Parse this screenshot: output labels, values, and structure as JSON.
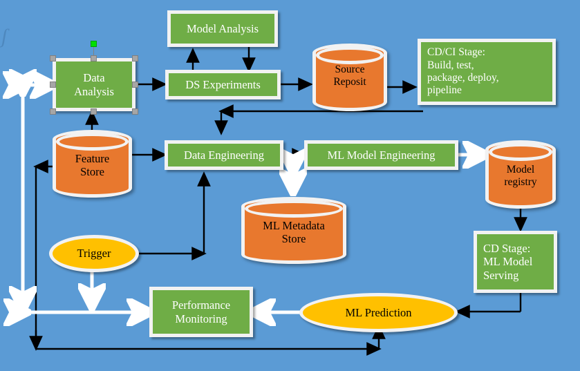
{
  "diagram": {
    "title": "MLOps pipeline flow diagram",
    "background_color": "#5B9BD5",
    "watermark": "ʃ",
    "colors": {
      "background": "#5B9BD5",
      "process_green": "#6FAD46",
      "datastore_orange": "#E8782E",
      "terminal_yellow": "#FFC000",
      "node_border": "#F2F2F2",
      "black_edge": "#000000",
      "white_edge": "#FFFFFF",
      "selection_handle": "#A6A6A6",
      "rotation_handle": "#00E000"
    },
    "nodes": [
      {
        "id": "data_analysis",
        "label": "Data\nAnalysis",
        "shape": "rectangle",
        "selected": true
      },
      {
        "id": "model_analysis",
        "label": "Model Analysis",
        "shape": "rectangle",
        "selected": false
      },
      {
        "id": "ds_experiments",
        "label": "DS Experiments",
        "shape": "rectangle",
        "selected": false
      },
      {
        "id": "source_repository",
        "label": "Source\nReposit",
        "shape": "cylinder",
        "clipped": true
      },
      {
        "id": "cd_ci_stage",
        "label": "CD/CI Stage:\nBuild, test,\npackage, deploy,\npipeline",
        "shape": "rectangle",
        "selected": false
      },
      {
        "id": "feature_store",
        "label": "Feature\nStore",
        "shape": "cylinder",
        "clipped": false
      },
      {
        "id": "data_engineering",
        "label": "Data Engineering",
        "shape": "rectangle",
        "selected": false
      },
      {
        "id": "ml_model_engineering",
        "label": "ML Model Engineering",
        "shape": "rectangle",
        "selected": false
      },
      {
        "id": "model_registry",
        "label": "Model\nregistry",
        "shape": "cylinder",
        "clipped": false
      },
      {
        "id": "ml_metadata_store",
        "label": "ML Metadata\nStore",
        "shape": "cylinder",
        "clipped": false
      },
      {
        "id": "cd_stage_serving",
        "label": "CD Stage:\nML Model\nServing",
        "shape": "rectangle",
        "selected": false
      },
      {
        "id": "trigger",
        "label": "Trigger",
        "shape": "ellipse",
        "selected": false
      },
      {
        "id": "performance_monitoring",
        "label": "Performance\nMonitoring",
        "shape": "rectangle",
        "selected": false
      },
      {
        "id": "ml_prediction",
        "label": "ML Prediction",
        "shape": "ellipse",
        "selected": false
      }
    ],
    "labels": {
      "data_analysis_line1": "Data",
      "data_analysis_line2": "Analysis",
      "model_analysis": "Model Analysis",
      "ds_experiments": "DS Experiments",
      "source_repository_line1": "Source",
      "source_repository_line2": "Reposit",
      "cd_ci_line1": "CD/CI Stage:",
      "cd_ci_line2": "Build, test,",
      "cd_ci_line3": "package, deploy,",
      "cd_ci_line4": "pipeline",
      "feature_store_line1": "Feature",
      "feature_store_line2": "Store",
      "data_engineering": "Data Engineering",
      "ml_model_engineering": "ML Model Engineering",
      "model_registry_line1": "Model",
      "model_registry_line2": "registry",
      "ml_metadata_line1": "ML Metadata",
      "ml_metadata_line2": "Store",
      "cd_stage_line1": "CD Stage:",
      "cd_stage_line2": "ML Model",
      "cd_stage_line3": "Serving",
      "trigger": "Trigger",
      "performance_line1": "Performance",
      "performance_line2": "Monitoring",
      "ml_prediction": "ML Prediction"
    },
    "edges": [
      {
        "from": "data_analysis",
        "to": "ds_experiments",
        "style": "black",
        "arrow": "single"
      },
      {
        "from": "ds_experiments",
        "to": "model_analysis",
        "style": "black",
        "arrow": "single"
      },
      {
        "from": "model_analysis",
        "to": "ds_experiments",
        "style": "black",
        "arrow": "single"
      },
      {
        "from": "ds_experiments",
        "to": "source_repository",
        "style": "black",
        "arrow": "single"
      },
      {
        "from": "source_repository",
        "to": "cd_ci_stage",
        "style": "black",
        "arrow": "single"
      },
      {
        "from": "cd_ci_stage",
        "to": "data_engineering",
        "style": "black",
        "arrow": "single"
      },
      {
        "from": "feature_store",
        "to": "data_analysis",
        "style": "black",
        "arrow": "single"
      },
      {
        "from": "feature_store",
        "to": "data_engineering",
        "style": "black",
        "arrow": "single"
      },
      {
        "from": "feature_store",
        "to": "left_bus",
        "style": "black",
        "arrow": "single"
      },
      {
        "from": "data_engineering",
        "to": "ml_model_engineering",
        "style": "black",
        "arrow": "single"
      },
      {
        "from": "ml_model_engineering",
        "to": "model_registry",
        "style": "white",
        "arrow": "single"
      },
      {
        "from": "data_engineering",
        "to": "ml_metadata_store",
        "style": "white",
        "arrow": "double"
      },
      {
        "from": "model_registry",
        "to": "cd_stage_serving",
        "style": "black",
        "arrow": "single"
      },
      {
        "from": "cd_stage_serving",
        "to": "ml_prediction",
        "style": "black",
        "arrow": "single"
      },
      {
        "from": "trigger",
        "to": "data_engineering",
        "style": "black",
        "arrow": "single"
      },
      {
        "from": "trigger",
        "to": "left_bus",
        "style": "white",
        "arrow": "double"
      },
      {
        "from": "left_bus",
        "to": "performance_monitoring",
        "style": "white",
        "arrow": "single"
      },
      {
        "from": "ml_prediction",
        "to": "performance_monitoring",
        "style": "white",
        "arrow": "single"
      },
      {
        "from": "left_bus",
        "to": "data_analysis",
        "style": "white",
        "arrow": "double"
      },
      {
        "from": "performance_monitoring",
        "to": "ml_prediction",
        "style": "black",
        "arrow": "single"
      }
    ]
  }
}
